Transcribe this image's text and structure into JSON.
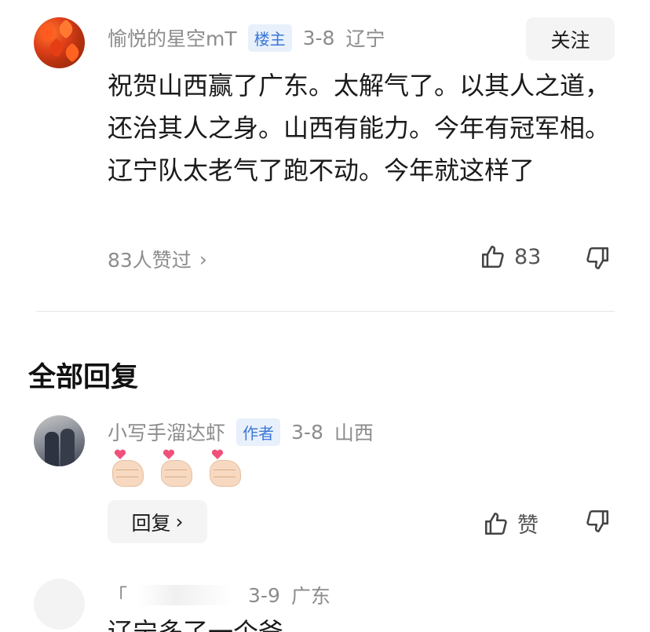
{
  "main_comment": {
    "user": "愉悦的星空mT",
    "badge": "楼主",
    "date": "3-8",
    "location": "辽宁",
    "follow_label": "关注",
    "text": "祝贺山西赢了广东。太解气了。以其人之道，还治其人之身。山西有能力。今年有冠军相。辽宁队太老气了跑不动。今年就这样了",
    "likes_summary": "83人赞过",
    "like_count": "83"
  },
  "replies_section": {
    "title": "全部回复"
  },
  "reply_1": {
    "user": "小写手溜达虾",
    "badge": "作者",
    "date": "3-8",
    "location": "山西",
    "emoji": [
      "heart-hands",
      "heart-hands",
      "heart-hands"
    ],
    "reply_label": "回复",
    "like_label": "赞"
  },
  "reply_2": {
    "user": "「",
    "date": "3-9",
    "location": "广东",
    "text": "辽宁多了一个爸"
  },
  "colors": {
    "badge_text": "#3a78d6",
    "badge_bg": "#e8f0fb",
    "meta_text": "#8c8c8c"
  }
}
